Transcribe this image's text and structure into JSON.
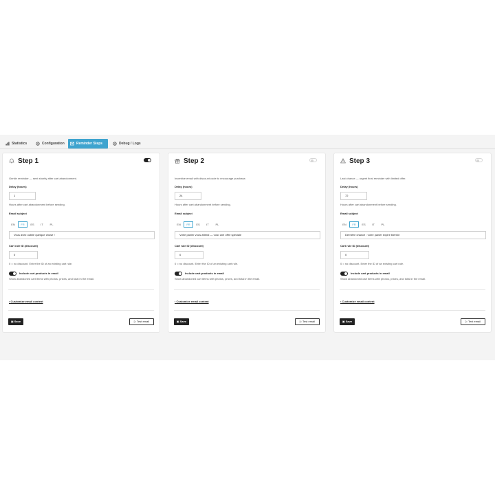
{
  "tabs": [
    {
      "label": "Statistics",
      "icon": "chart-icon"
    },
    {
      "label": "Configuration",
      "icon": "gear-icon"
    },
    {
      "label": "Reminder Steps",
      "icon": "mail-icon"
    },
    {
      "label": "Debug / Logs",
      "icon": "gear-icon"
    }
  ],
  "active_tab": "Reminder Steps",
  "colors": {
    "accent": "#3fa4cf",
    "dark": "#222222"
  },
  "labels": {
    "delay": "Delay (hours)",
    "delay_help": "Hours after cart abandonment before sending.",
    "subject": "Email subject",
    "rule": "Cart rule ID (discount)",
    "rule_help": "0 = no discount. Enter the ID of an existing cart rule.",
    "include": "Include cart products in email",
    "include_help": "Show abandoned cart items with photos, prices, and total in the email.",
    "customize": "Customize email content",
    "save": "Save",
    "test": "Test email"
  },
  "languages": [
    "EN",
    "FR",
    "ES",
    "IT",
    "PL"
  ],
  "steps": [
    {
      "title": "Step 1",
      "icon": "bell-icon",
      "enabled": true,
      "description": "Gentle reminder — sent shortly after cart abandonment.",
      "delay": "1",
      "active_lang": "FR",
      "subject": "Vous avez oublié quelque chose !",
      "cart_rule": "0",
      "include_products": true
    },
    {
      "title": "Step 2",
      "icon": "gift-icon",
      "enabled": false,
      "description": "Incentive email with discount code to encourage purchase.",
      "delay": "24",
      "active_lang": "FR",
      "subject": "Votre panier vous attend — voici une offre spéciale",
      "cart_rule": "0",
      "include_products": true
    },
    {
      "title": "Step 3",
      "icon": "warning-icon",
      "enabled": false,
      "description": "Last chance — urgent final reminder with limited offer.",
      "delay": "72",
      "active_lang": "FR",
      "subject": "Dernière chance : votre panier expire bientôt",
      "cart_rule": "0",
      "include_products": true
    }
  ]
}
